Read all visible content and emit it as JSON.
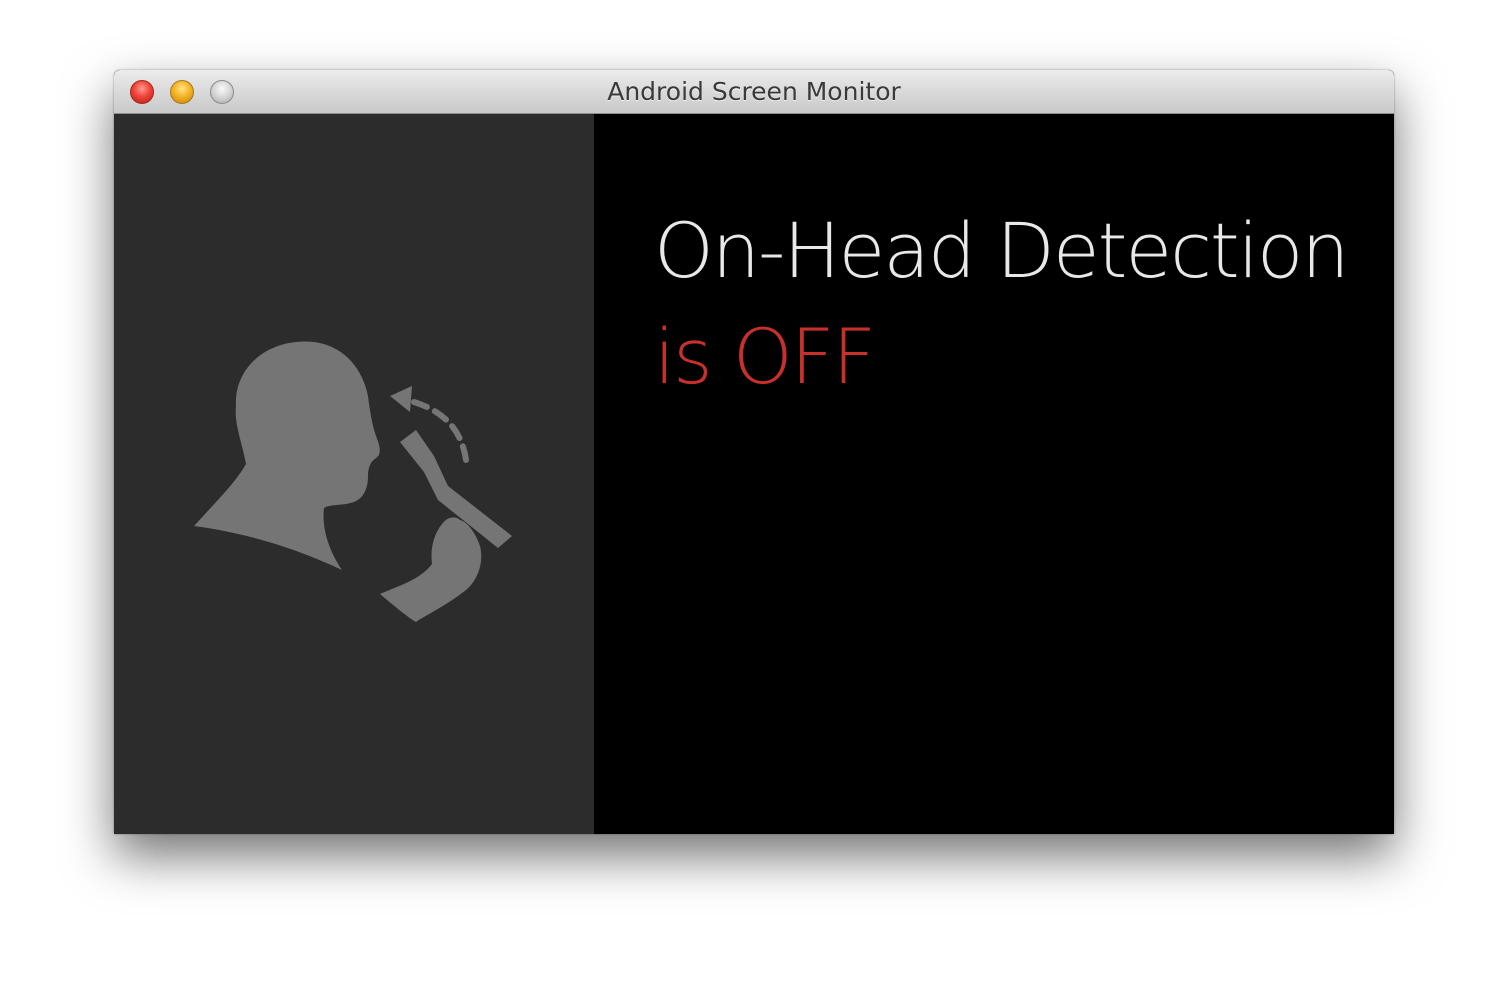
{
  "window": {
    "title": "Android Screen Monitor",
    "controls": {
      "close": "close-button",
      "minimize": "minimize-button",
      "zoom": "zoom-button"
    }
  },
  "screen": {
    "illustration_icon": "head-with-glass-icon",
    "heading": "On-Head Detection",
    "status": "is OFF",
    "colors": {
      "left_panel": "#2c2c2c",
      "right_panel": "#000000",
      "heading": "#e8e8e8",
      "status": "#c8302c",
      "illustration": "#757575"
    }
  }
}
